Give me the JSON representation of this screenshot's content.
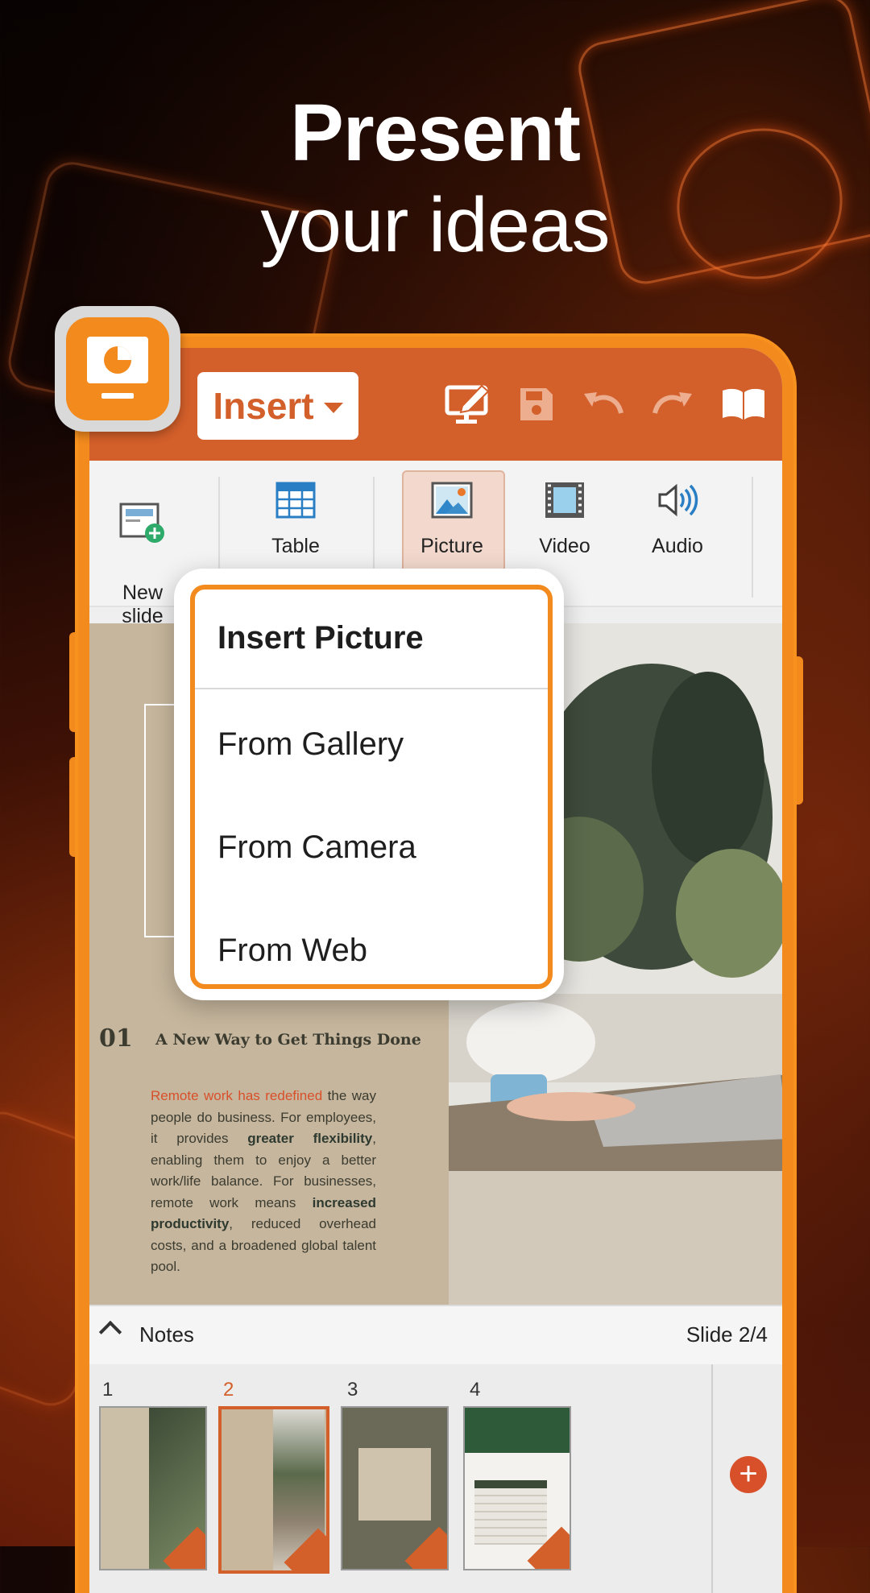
{
  "headline": {
    "line1": "Present",
    "line2": "your ideas"
  },
  "toolbar": {
    "menu_label": "Insert",
    "icons": [
      "pen-monitor-icon",
      "save-icon",
      "undo-icon",
      "redo-icon",
      "book-icon"
    ]
  },
  "ribbon": {
    "items": [
      {
        "label": "New\nslide",
        "icon": "new-slide-icon"
      },
      {
        "label": "Table",
        "icon": "table-icon"
      },
      {
        "label": "Picture",
        "icon": "picture-icon",
        "active": true
      },
      {
        "label": "Video",
        "icon": "video-icon"
      },
      {
        "label": "Audio",
        "icon": "audio-icon"
      }
    ]
  },
  "popup": {
    "title": "Insert Picture",
    "options": [
      "From Gallery",
      "From Camera",
      "From Web"
    ]
  },
  "slide": {
    "number": "01",
    "title": "A New Way to Get Things Done",
    "body_highlight": "Remote work has redefined",
    "body_1": " the way people do business. For employees, it provides ",
    "body_bold_1": "greater flexibility",
    "body_2": ", enabling them to enjoy a better work/life balance. For businesses, remote work means ",
    "body_bold_2": "increased productivity",
    "body_3": ", reduced overhead costs, and a broadened global talent pool."
  },
  "notes": {
    "label": "Notes",
    "slide_counter": "Slide 2/4"
  },
  "thumbnails": [
    {
      "num": "1"
    },
    {
      "num": "2",
      "selected": true
    },
    {
      "num": "3"
    },
    {
      "num": "4"
    }
  ],
  "colors": {
    "accent": "#f28a1e",
    "toolbar": "#d35f2a",
    "highlight": "#d8502a"
  }
}
